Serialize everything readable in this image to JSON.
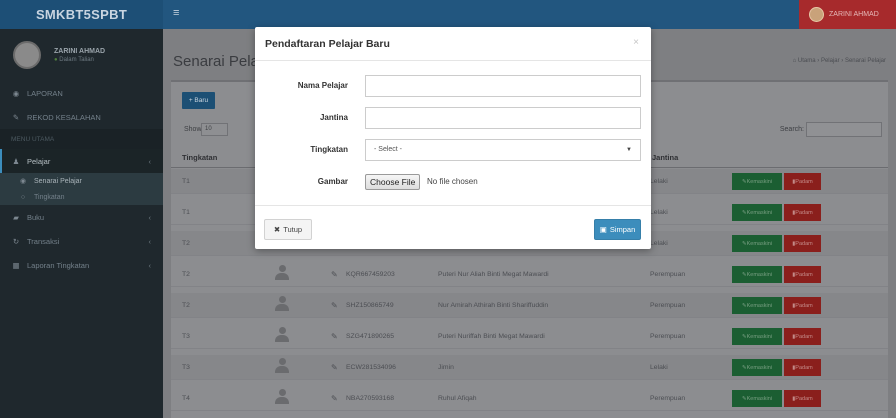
{
  "app": {
    "logo": "SMKBT5SPBT",
    "toggle_icon": "≡",
    "user_name": "ZARINI AHMAD"
  },
  "sidebar": {
    "user_name": "ZARINI AHMAD",
    "user_status": "Dalam Talian",
    "menu_header": "MENU UTAMA",
    "items": [
      {
        "label": "LAPORAN",
        "icon": "dashboard-icon"
      },
      {
        "label": "REKOD KESALAHAN",
        "icon": "edit-icon"
      }
    ],
    "pelajar": {
      "label": "Pelajar",
      "sub": [
        "Senarai Pelajar",
        "Tingkatan"
      ]
    },
    "more": [
      {
        "label": "Buku",
        "icon": "book-icon"
      },
      {
        "label": "Transaksi",
        "icon": "refresh-icon"
      },
      {
        "label": "Laporan Tingkatan",
        "icon": "report-icon"
      }
    ]
  },
  "content": {
    "title": "Senarai Pelajar",
    "breadcrumb": [
      "Utama",
      "Pelajar",
      "Senarai Pelajar"
    ],
    "new_button": "+ Baru",
    "show_label": "Show",
    "show_value": "10",
    "search_label": "Search:",
    "columns": [
      "Tingkatan",
      "Jantina"
    ]
  },
  "table": {
    "rows": [
      {
        "tingkatan": "T1",
        "ic": "",
        "nama": "",
        "jantina": "Lelaki"
      },
      {
        "tingkatan": "T1",
        "ic": "",
        "nama": "",
        "jantina": "Lelaki"
      },
      {
        "tingkatan": "T2",
        "ic": "",
        "nama": "",
        "jantina": "Lelaki"
      },
      {
        "tingkatan": "T2",
        "ic": "KQR667459203",
        "nama": "Puteri Nur Aliah Binti Megat Mawardi",
        "jantina": "Perempuan"
      },
      {
        "tingkatan": "T2",
        "ic": "SHZ150865749",
        "nama": "Nur Amirah Athirah Binti Shariffuddin",
        "jantina": "Perempuan"
      },
      {
        "tingkatan": "T3",
        "ic": "SZG471890265",
        "nama": "Puteri Nuriffah Binti Megat Mawardi",
        "jantina": "Perempuan"
      },
      {
        "tingkatan": "T3",
        "ic": "ECW281534096",
        "nama": "Jimin",
        "jantina": "Lelaki"
      },
      {
        "tingkatan": "T4",
        "ic": "NBA270593168",
        "nama": "Ruhul Afiqah",
        "jantina": "Perempuan"
      }
    ],
    "edit_label": "Kemaskini",
    "delete_label": "Padam"
  },
  "modal": {
    "title": "Pendaftaran Pelajar Baru",
    "close_icon": "×",
    "fields": {
      "nama_label": "Nama Pelajar",
      "nama_value": "",
      "jantina_label": "Jantina",
      "jantina_value": "",
      "tingkatan_label": "Tingkatan",
      "tingkatan_value": "- Select -",
      "gambar_label": "Gambar",
      "file_button": "Choose File",
      "file_status": "No file chosen"
    },
    "tutup_label": "Tutup",
    "simpan_label": "Simpan"
  }
}
